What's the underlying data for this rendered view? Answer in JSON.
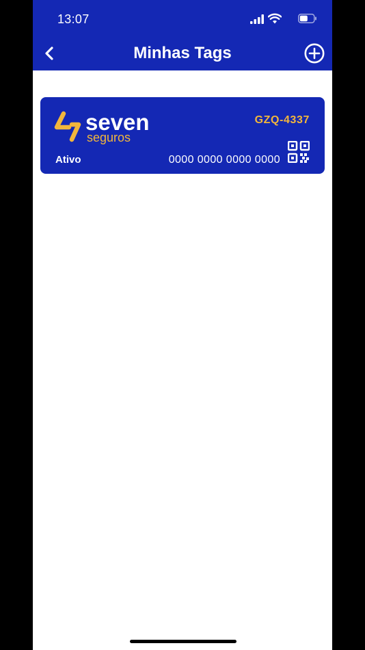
{
  "status_bar": {
    "time": "13:07"
  },
  "nav": {
    "title": "Minhas Tags",
    "back_icon": "chevron-left-icon",
    "add_icon": "plus-circle-icon"
  },
  "tag_card": {
    "brand_name": "seven",
    "brand_sub": "seguros",
    "plate": "GZQ-4337",
    "status": "Ativo",
    "number": "0000 0000 0000 0000",
    "qr_icon": "qr-code-icon"
  },
  "colors": {
    "primary_blue": "#1428b4",
    "accent_yellow": "#f2b63c",
    "text_white": "#ffffff"
  }
}
